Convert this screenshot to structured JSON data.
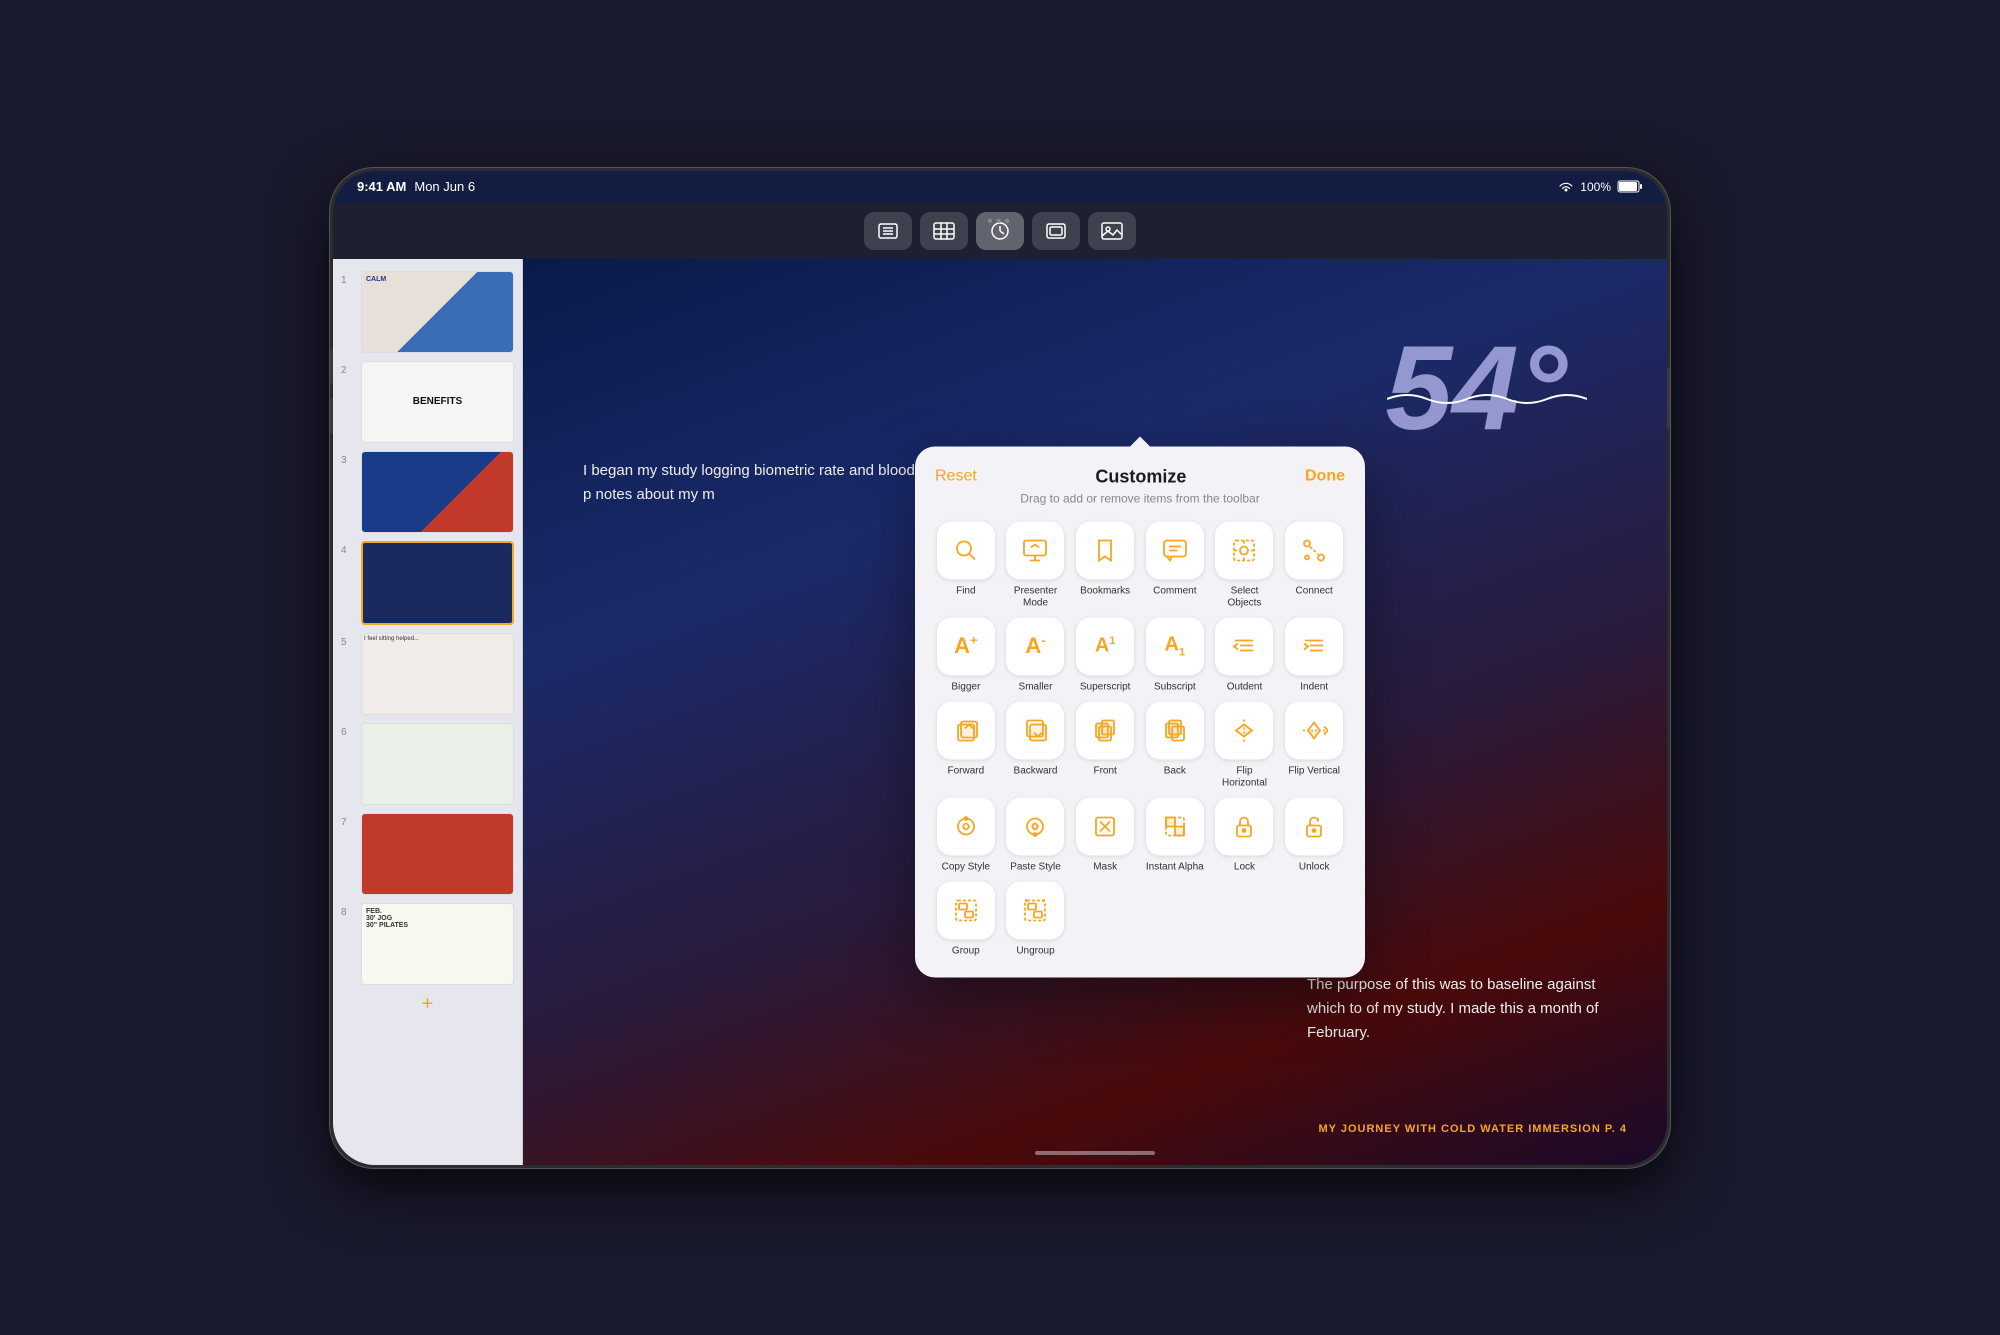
{
  "status": {
    "time": "9:41 AM",
    "date": "Mon Jun 6",
    "battery": "100%"
  },
  "toolbar": {
    "dots": "•••",
    "buttons": [
      {
        "id": "list",
        "label": "List View"
      },
      {
        "id": "table",
        "label": "Table"
      },
      {
        "id": "clock",
        "label": "Recent"
      },
      {
        "id": "layers",
        "label": "Layers"
      },
      {
        "id": "media",
        "label": "Media"
      }
    ]
  },
  "dialog": {
    "title": "Customize",
    "reset_label": "Reset",
    "done_label": "Done",
    "subtitle": "Drag to add or remove items from the toolbar",
    "tools": [
      {
        "id": "find",
        "label": "Find",
        "icon": "🔍"
      },
      {
        "id": "presenter",
        "label": "Presenter Mode",
        "icon": "🖥"
      },
      {
        "id": "bookmarks",
        "label": "Bookmarks",
        "icon": "🔖"
      },
      {
        "id": "comment",
        "label": "Comment",
        "icon": "💬"
      },
      {
        "id": "select-objects",
        "label": "Select Objects",
        "icon": "⊙"
      },
      {
        "id": "connect",
        "label": "Connect",
        "icon": "⚓"
      },
      {
        "id": "bigger",
        "label": "Bigger",
        "icon": "A+"
      },
      {
        "id": "smaller",
        "label": "Smaller",
        "icon": "A-"
      },
      {
        "id": "superscript",
        "label": "Superscript",
        "icon": "A¹"
      },
      {
        "id": "subscript",
        "label": "Subscript",
        "icon": "A₁"
      },
      {
        "id": "outdent",
        "label": "Outdent",
        "icon": "≡←"
      },
      {
        "id": "indent",
        "label": "Indent",
        "icon": "→≡"
      },
      {
        "id": "forward",
        "label": "Forward",
        "icon": "⬆"
      },
      {
        "id": "backward",
        "label": "Backward",
        "icon": "⬇"
      },
      {
        "id": "front",
        "label": "Front",
        "icon": "⏫"
      },
      {
        "id": "back",
        "label": "Back",
        "icon": "⏬"
      },
      {
        "id": "flip-horizontal",
        "label": "Flip Horizontal",
        "icon": "↔"
      },
      {
        "id": "flip-vertical",
        "label": "Flip Vertical",
        "icon": "↕"
      },
      {
        "id": "copy-style",
        "label": "Copy Style",
        "icon": "⚡"
      },
      {
        "id": "paste-style",
        "label": "Paste Style",
        "icon": "⚡"
      },
      {
        "id": "mask",
        "label": "Mask",
        "icon": "✂"
      },
      {
        "id": "instant-alpha",
        "label": "Instant Alpha",
        "icon": "⬜"
      },
      {
        "id": "lock",
        "label": "Lock",
        "icon": "🔒"
      },
      {
        "id": "unlock",
        "label": "Unlock",
        "icon": "🔓"
      },
      {
        "id": "group",
        "label": "Group",
        "icon": "⬛"
      },
      {
        "id": "ungroup",
        "label": "Ungroup",
        "icon": "⬛"
      }
    ]
  },
  "document": {
    "big_number": "54°",
    "body_text_1": "I began my study logging biometric rate and blood p notes about my m",
    "purpose_text": "The purpose of this was to baseline against which to of my study. I made this a month of February.",
    "footer": "MY JOURNEY WITH COLD WATER IMMERSION    P. 4",
    "handwritten": "FEB.\n30' JOG\n30\" PILATES"
  },
  "sidebar": {
    "pages": [
      {
        "num": "1",
        "type": "calm"
      },
      {
        "num": "2",
        "type": "benefits"
      },
      {
        "num": "3",
        "type": "blue-red"
      },
      {
        "num": "4",
        "type": "dark-blue",
        "selected": true
      },
      {
        "num": "5",
        "type": "notes"
      },
      {
        "num": "6",
        "type": "green"
      },
      {
        "num": "7",
        "type": "red"
      },
      {
        "num": "8",
        "type": "handwritten"
      }
    ],
    "add_button": "+"
  }
}
